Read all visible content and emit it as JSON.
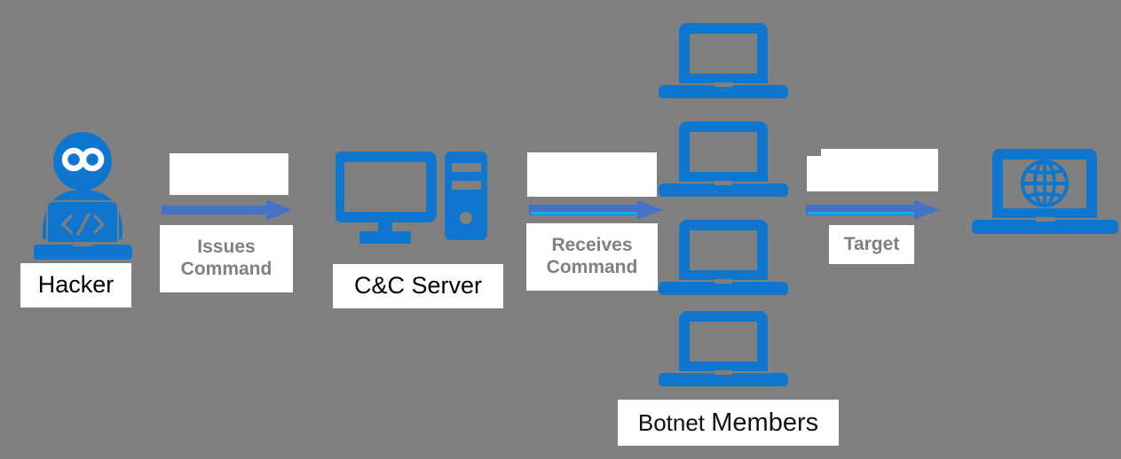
{
  "diagram": {
    "title": "Botnet command-and-control attack flow",
    "background_color": "#808080",
    "accent_blue": "#0f76ce",
    "arrow_blue": "#4472c4",
    "arrow_highlight": "#00b0f0",
    "label_gray": "#808080"
  },
  "nodes": {
    "hacker": {
      "label": "Hacker",
      "icon": "hacker-with-laptop-icon"
    },
    "cnc_server": {
      "label": "C&C Server",
      "icon": "desktop-computer-tower-icon"
    },
    "botnet": {
      "label_part1": "Botnet ",
      "label_part2": "Members",
      "icon": "laptop-icon",
      "member_count": 4
    },
    "target": {
      "label": "",
      "icon": "laptop-globe-icon"
    }
  },
  "arrows": [
    {
      "name": "issues-command-arrow",
      "label_line1": "Issues",
      "label_line2": "Command",
      "has_highlight": false
    },
    {
      "name": "receives-command-arrow",
      "label_line1": "Receives",
      "label_line2": "Command",
      "has_highlight": true
    },
    {
      "name": "target-arrow",
      "label_line1": "Target",
      "label_line2": "",
      "has_highlight": true
    }
  ]
}
